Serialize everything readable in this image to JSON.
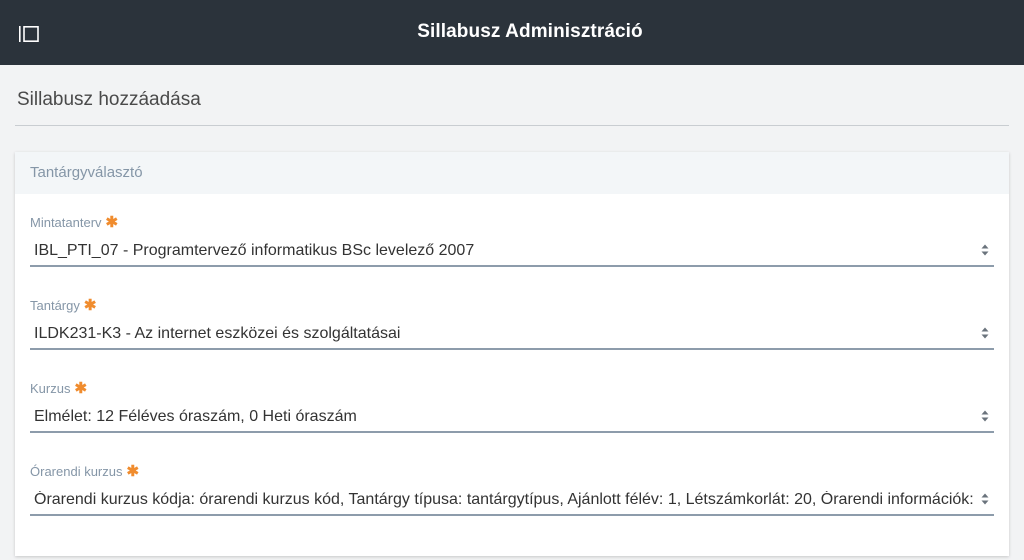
{
  "header": {
    "title": "Sillabusz Adminisztráció",
    "menu_icon": "sidebar-toggle-icon",
    "background": "#2b333b"
  },
  "page": {
    "title": "Sillabusz hozzáadása"
  },
  "card": {
    "title": "Tantárgyválasztó"
  },
  "form": {
    "required_marker": "✱",
    "required_color": "#f08c2e",
    "fields": [
      {
        "label": "Mintatanterv",
        "value": "IBL_PTI_07 - Programtervező informatikus BSc levelező 2007",
        "icon": "select-arrows-icon"
      },
      {
        "label": "Tantárgy",
        "value": "ILDK231-K3 - Az internet eszközei és szolgáltatásai",
        "icon": "select-arrows-icon"
      },
      {
        "label": "Kurzus",
        "value": "Elmélet: 12 Féléves óraszám, 0 Heti óraszám",
        "icon": "select-arrows-icon"
      },
      {
        "label": "Órarendi kurzus",
        "value": "Órarendi kurzus kódja: órarendi kurzus kód, Tantárgy típusa: tantárgytípus, Ajánlott félév: 1, Létszámkorlát: 20, Órarendi információk:",
        "icon": "select-arrows-icon"
      }
    ]
  }
}
